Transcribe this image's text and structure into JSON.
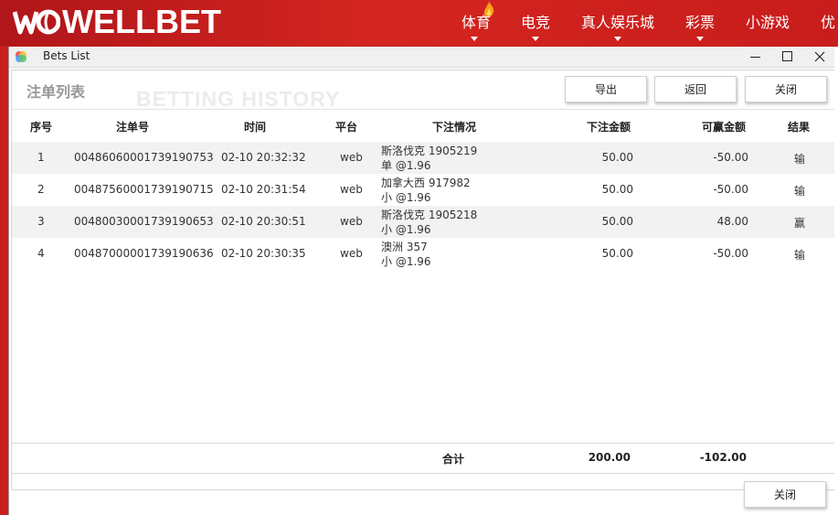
{
  "site": {
    "brand": "WELLBET",
    "logo_mark": "WB",
    "nav": [
      {
        "label": "体育",
        "caret": true
      },
      {
        "label": "电竞",
        "caret": true
      },
      {
        "label": "真人娱乐城",
        "caret": true
      },
      {
        "label": "彩票",
        "caret": true
      },
      {
        "label": "小游戏",
        "caret": false
      },
      {
        "label": "优",
        "caret": false
      }
    ]
  },
  "window": {
    "title": "Bets List",
    "controls": [
      "minimize-icon",
      "maximize-icon",
      "close-icon"
    ]
  },
  "panel": {
    "title": "注单列表",
    "watermark": "BETTING HISTORY",
    "buttons": {
      "export": "导出",
      "back": "返回",
      "close": "关闭"
    }
  },
  "table": {
    "headers": [
      "序号",
      "注单号",
      "时间",
      "平台",
      "下注情况",
      "下注金额",
      "可赢金额",
      "结果"
    ],
    "rows": [
      {
        "no": "1",
        "id": "00486060001739190753",
        "time": "02-10 20:32:32",
        "platform": "web",
        "event": "斯洛伐克 1905219",
        "pick": "单 @1.96",
        "stake": "50.00",
        "win": "-50.00",
        "result": "输"
      },
      {
        "no": "2",
        "id": "00487560001739190715",
        "time": "02-10 20:31:54",
        "platform": "web",
        "event": "加拿大西 917982",
        "pick": "小 @1.96",
        "stake": "50.00",
        "win": "-50.00",
        "result": "输"
      },
      {
        "no": "3",
        "id": "00480030001739190653",
        "time": "02-10 20:30:51",
        "platform": "web",
        "event": "斯洛伐克 1905218",
        "pick": "小 @1.96",
        "stake": "50.00",
        "win": "48.00",
        "result": "赢"
      },
      {
        "no": "4",
        "id": "00487000001739190636",
        "time": "02-10 20:30:35",
        "platform": "web",
        "event": "澳洲 357",
        "pick": "小 @1.96",
        "stake": "50.00",
        "win": "-50.00",
        "result": "输"
      }
    ],
    "total": {
      "label": "合计",
      "stake": "200.00",
      "win": "-102.00"
    }
  },
  "footer": {
    "close": "关闭"
  }
}
